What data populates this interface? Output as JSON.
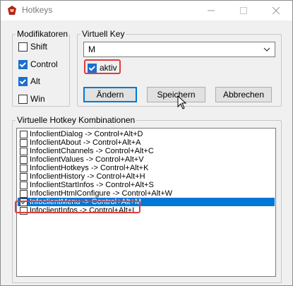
{
  "window": {
    "title": "Hotkeys",
    "controls": [
      "minimize-icon",
      "maximize-icon",
      "close-icon"
    ]
  },
  "modifiers": {
    "legend": "Modifikatoren",
    "items": [
      {
        "label": "Shift",
        "checked": false
      },
      {
        "label": "Control",
        "checked": true
      },
      {
        "label": "Alt",
        "checked": true
      },
      {
        "label": "Win",
        "checked": false
      }
    ]
  },
  "virtual_key": {
    "legend": "Virtuell Key",
    "selected_value": "M",
    "active_label": "aktiv",
    "active_checked": true
  },
  "buttons": {
    "change": "Ändern",
    "save": "Speichern",
    "cancel": "Abbrechen"
  },
  "combinations": {
    "legend": "Virtuelle Hotkey Kombinationen",
    "items": [
      {
        "label": "InfoclientDialog -> Control+Alt+D",
        "checked": false
      },
      {
        "label": "InfoclientAbout -> Control+Alt+A",
        "checked": false
      },
      {
        "label": "InfoclientChannels -> Control+Alt+C",
        "checked": false
      },
      {
        "label": "InfoclientValues -> Control+Alt+V",
        "checked": false
      },
      {
        "label": "InfoclientHotkeys -> Control+Alt+K",
        "checked": false
      },
      {
        "label": "InfoclientHistory -> Control+Alt+H",
        "checked": false
      },
      {
        "label": "InfoclientStartInfos -> Control+Alt+S",
        "checked": false
      },
      {
        "label": "InfoclientHtmlConfigure -> Control+Alt+W",
        "checked": false
      },
      {
        "label": "InfoclientMenu -> Control+Alt+M",
        "checked": true,
        "selected": true
      },
      {
        "label": "InfoclientInfos -> Control+Alt+I",
        "checked": false
      }
    ]
  },
  "colors": {
    "selection": "#0078d7",
    "highlight": "#e03c3c"
  }
}
